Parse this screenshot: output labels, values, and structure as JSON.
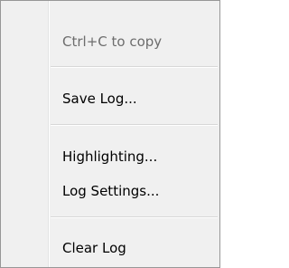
{
  "menu": {
    "items": [
      {
        "label": "Ctrl+C to copy",
        "enabled": false
      },
      {
        "label": "Save Log..."
      },
      {
        "label": "Highlighting..."
      },
      {
        "label": "Log Settings..."
      },
      {
        "label": "Clear Log"
      }
    ]
  }
}
